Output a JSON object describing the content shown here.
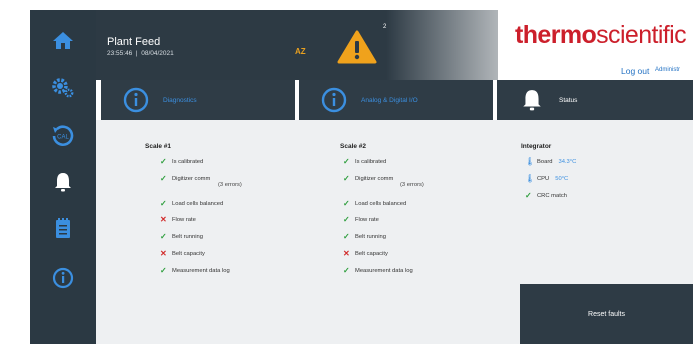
{
  "header": {
    "title": "Plant Feed",
    "clock": "23:55:46  |  08/04/2021",
    "user_initials": "AZ",
    "alert_count": "2",
    "brand_bold": "thermo",
    "brand_regular": "scientific",
    "logout_label": "Log out",
    "account_label": "Administr"
  },
  "sidebar": {
    "items": [
      {
        "icon": "home-icon"
      },
      {
        "icon": "settings-icon"
      },
      {
        "icon": "calibration-icon",
        "label": "CAL"
      },
      {
        "icon": "bell-icon"
      },
      {
        "icon": "notepad-icon"
      },
      {
        "icon": "info-icon"
      }
    ]
  },
  "tabs": [
    {
      "label": "Diagnostics",
      "icon": "info-icon"
    },
    {
      "label": "Analog & Digital I/O",
      "icon": "info-icon"
    },
    {
      "label": "Status",
      "icon": "bell-icon"
    }
  ],
  "scale1": {
    "title": "Scale #1",
    "rows": [
      {
        "text": "Is calibrated",
        "ok": true
      },
      {
        "text": "Digitizer comm",
        "ok": true,
        "note": "(3 errors)"
      },
      {
        "text": "Load cells balanced",
        "ok": true
      },
      {
        "text": "Flow rate",
        "ok": false
      },
      {
        "text": "Belt running",
        "ok": true
      },
      {
        "text": "Belt capacity",
        "ok": false
      },
      {
        "text": "Measurement data log",
        "ok": true
      }
    ]
  },
  "scale2": {
    "title": "Scale #2",
    "rows": [
      {
        "text": "Is calibrated",
        "ok": true
      },
      {
        "text": "Digitizer comm",
        "ok": true,
        "note": "(3 errors)"
      },
      {
        "text": "Load cells balanced",
        "ok": true
      },
      {
        "text": "Flow rate",
        "ok": true
      },
      {
        "text": "Belt running",
        "ok": true
      },
      {
        "text": "Belt capacity",
        "ok": false
      },
      {
        "text": "Measurement data log",
        "ok": true
      }
    ]
  },
  "integrator": {
    "title": "Integrator",
    "board_label": "Board",
    "board_value": "34.3°C",
    "cpu_label": "CPU",
    "cpu_value": "50°C",
    "crc_label": "CRC match"
  },
  "actions": {
    "reset_label": "Reset faults"
  },
  "colors": {
    "panel": "#2b3943",
    "accent_blue": "#3b8fe0",
    "brand_red": "#cc1f2b",
    "ok_green": "#2e9e3e",
    "fail_red": "#d12a2a",
    "warning_orange": "#f0a21c"
  }
}
